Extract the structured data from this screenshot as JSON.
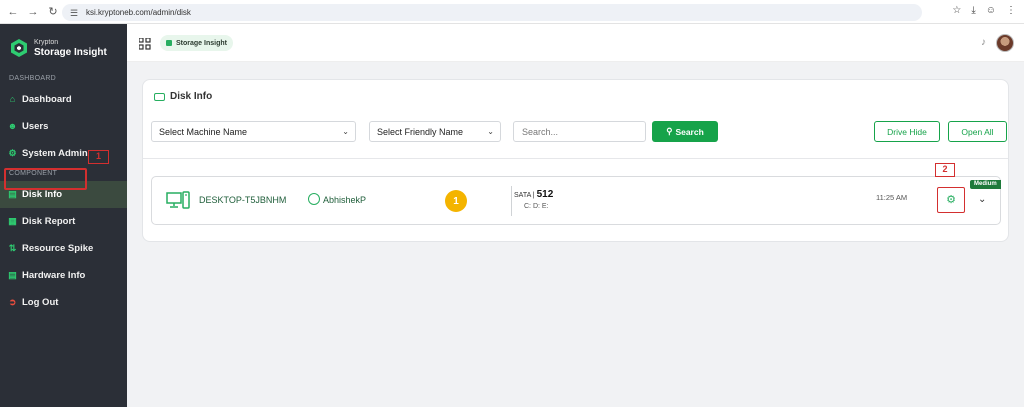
{
  "browser": {
    "url": "ksi.kryptoneb.com/admin/disk"
  },
  "brand": {
    "small": "Krypton",
    "big": "Storage Insight"
  },
  "sidebar": {
    "section_dashboard": "DASHBOARD",
    "section_component": "COMPONENT",
    "items": [
      {
        "label": "Dashboard",
        "icon": "home-icon"
      },
      {
        "label": "Users",
        "icon": "user-icon"
      },
      {
        "label": "System Admin",
        "icon": "gear-icon"
      },
      {
        "label": "Disk Info",
        "icon": "disk-icon",
        "active": true
      },
      {
        "label": "Disk Report",
        "icon": "report-icon"
      },
      {
        "label": "Resource Spike",
        "icon": "spike-icon"
      },
      {
        "label": "Hardware Info",
        "icon": "hardware-icon"
      },
      {
        "label": "Log Out",
        "icon": "logout-icon"
      }
    ]
  },
  "topbar": {
    "chip_label": "Storage Insight"
  },
  "card": {
    "title": "Disk Info",
    "machine_select": "Select Machine Name",
    "friendly_select": "Select Friendly Name",
    "search_placeholder": "Search...",
    "search_button": "Search",
    "drive_hide_button": "Drive Hide",
    "open_all_button": "Open All"
  },
  "row": {
    "machine_name": "DESKTOP-T5JBNHM",
    "user_name": "AbhishekP",
    "count": "1",
    "interface": "SATA",
    "size": "512",
    "drives": "C: D: E:",
    "time": "11:25 AM",
    "severity": "Medium"
  },
  "annotations": {
    "marker_1": "1",
    "marker_2": "2"
  },
  "colors": {
    "sidebar_bg": "#2b2f37",
    "accent_green": "#16a34a",
    "badge_yellow": "#f4b400",
    "annotation_red": "#d32f2f"
  }
}
